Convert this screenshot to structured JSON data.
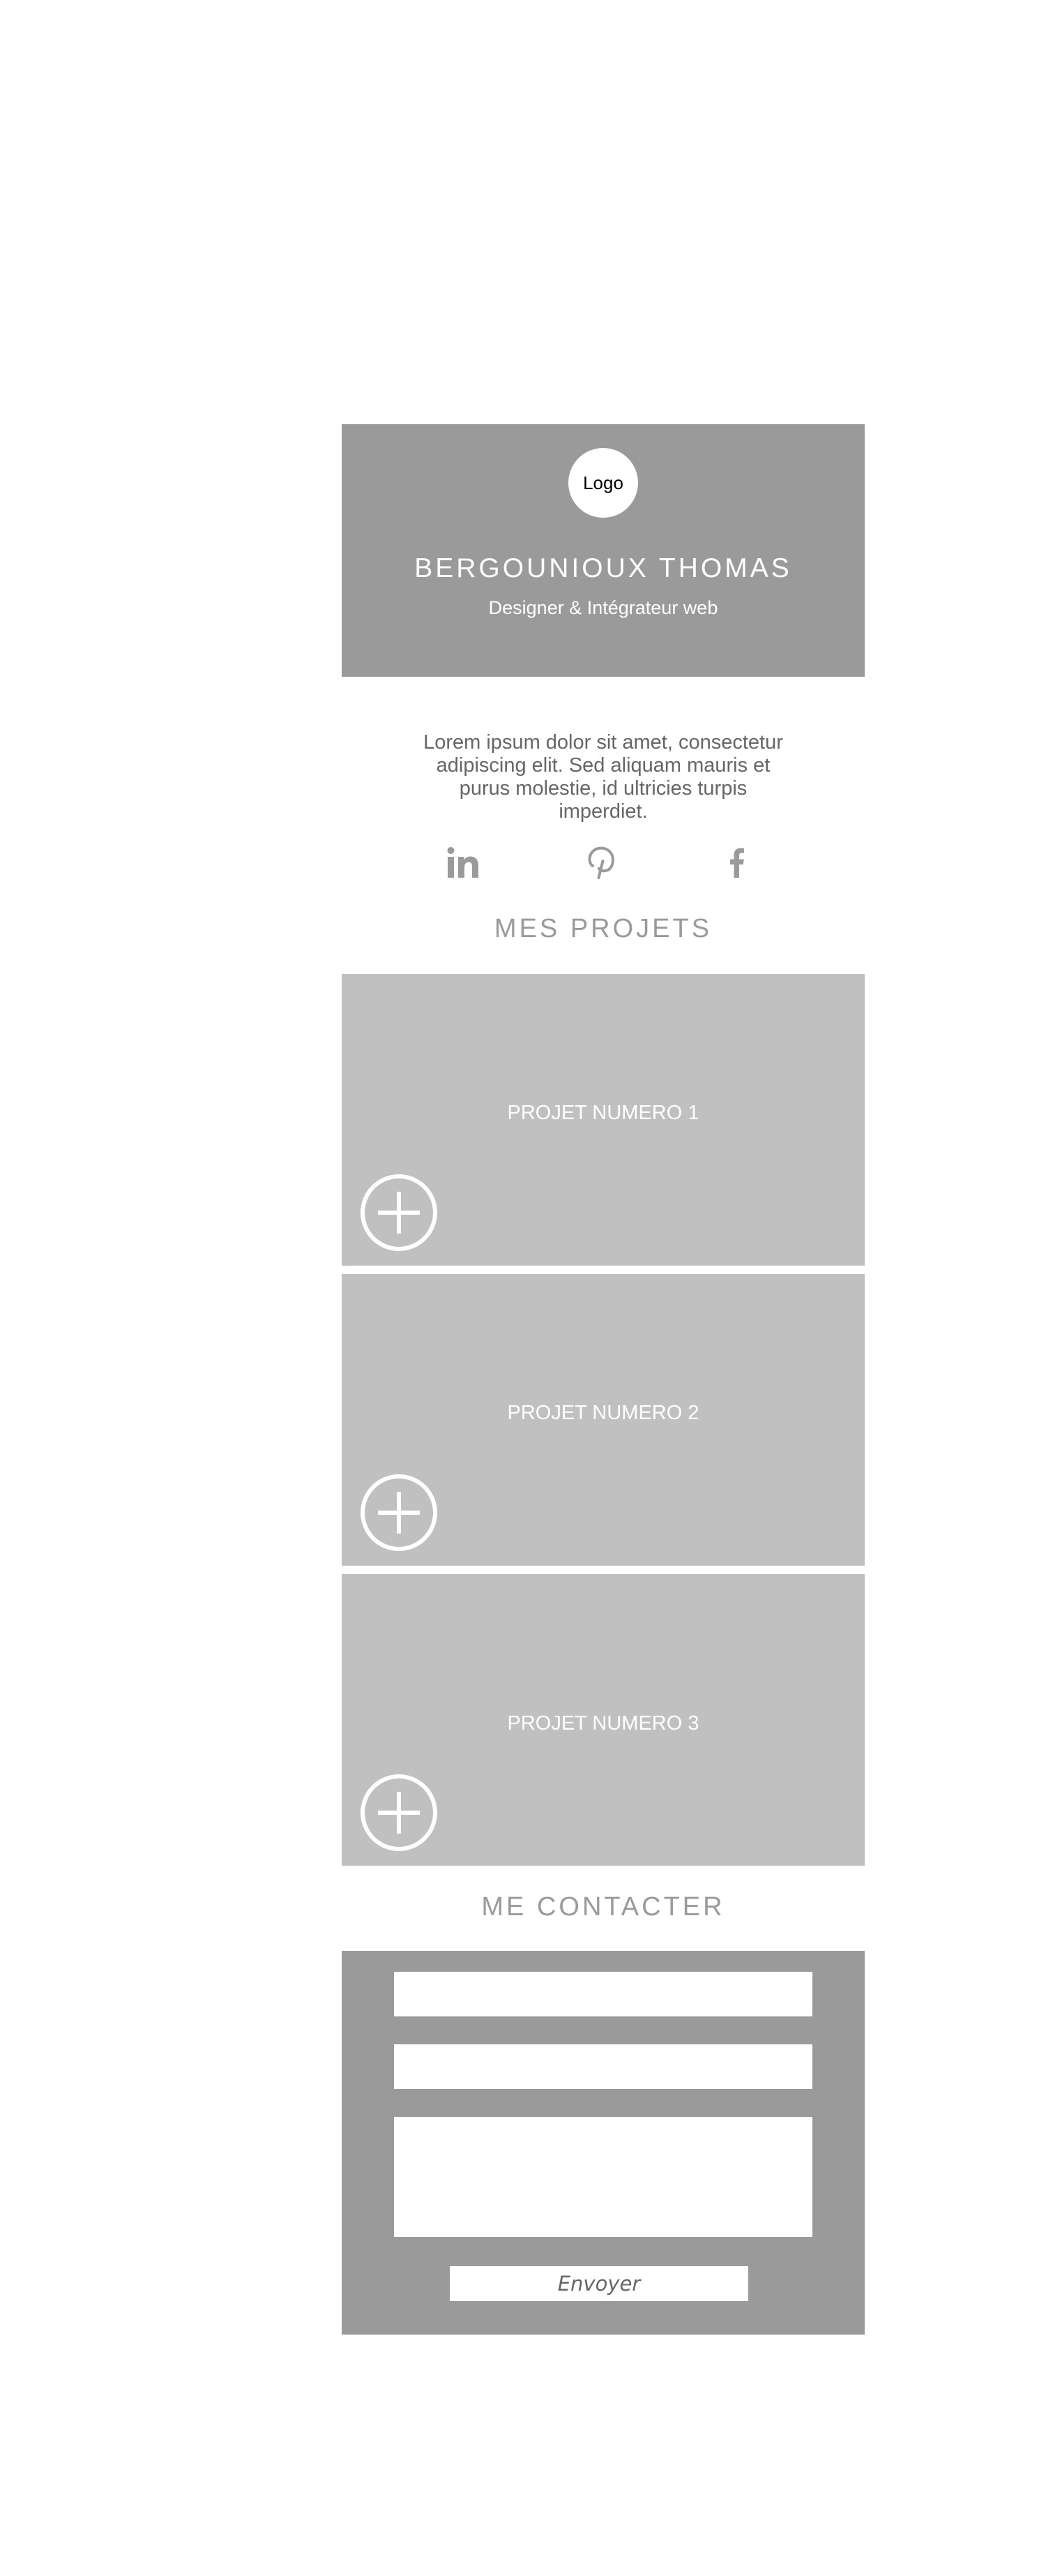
{
  "header": {
    "logo_text": "Logo",
    "name": "BERGOUNIOUX THOMAS",
    "role": "Designer & Intégrateur web"
  },
  "intro": {
    "text": "Lorem ipsum dolor sit amet, consectetur adipiscing elit. Sed aliquam mauris et purus molestie, id ultricies turpis imperdiet."
  },
  "social": {
    "icons": [
      "linkedin-icon",
      "pinterest-icon",
      "facebook-icon"
    ],
    "color": "#9a9a9a"
  },
  "projects": {
    "title": "MES PROJETS",
    "items": [
      {
        "label": "PROJET NUMERO 1"
      },
      {
        "label": "PROJET NUMERO 2"
      },
      {
        "label": "PROJET NUMERO 3"
      }
    ]
  },
  "contact": {
    "title": "ME CONTACTER",
    "field1_value": "",
    "field2_value": "",
    "message_value": "",
    "submit_label": "Envoyer"
  },
  "colors": {
    "header_bg": "#9a9a9a",
    "project_bg": "#c0c0c0",
    "contact_bg": "#9a9a9a",
    "text_muted": "#666666"
  }
}
